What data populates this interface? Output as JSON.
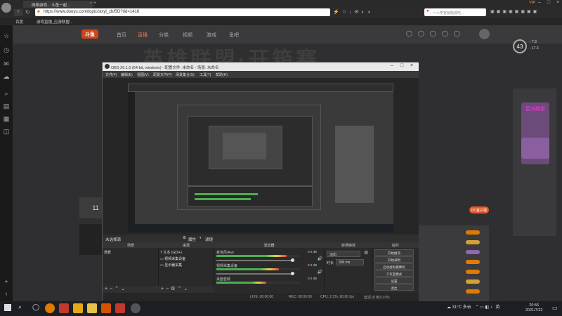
{
  "browser": {
    "tab_title": "网络游戏... 斗鱼一起...",
    "new_tab_icon": "plus-icon",
    "vip_label": "VIP",
    "url": "https://www.douyu.com/topic/stxyl_zb/BD?rid=1416",
    "search_placeholder": "一人吃官就能成吃...",
    "bookmarks": [
      "百度",
      "游戏直播_应游联盟..."
    ]
  },
  "site": {
    "logo_text": "斗鱼",
    "nav": [
      "首页",
      "直播",
      "分类",
      "视频",
      "游戏",
      "鱼吧"
    ],
    "banner_title": "英雄联盟·开箱赛",
    "level": "43",
    "speed_up": "7.3",
    "speed_down": "17.3",
    "promo_text": "星光殿堂",
    "date_day": "11",
    "pc_button": "PC客户端"
  },
  "obs": {
    "title": "OBS 26.1.0 (64-bit, windows) - 配置文件: 未命名 - 场景: 未命名",
    "menu": [
      "文件(F)",
      "编辑(E)",
      "视图(V)",
      "配置文件(P)",
      "场景集合(S)",
      "工具(T)",
      "帮助(H)"
    ],
    "scene_bar": {
      "current": "未选择源",
      "properties": "属性",
      "filters": "滤镜"
    },
    "docks": {
      "scenes": {
        "title": "场景",
        "items": [
          "场景"
        ]
      },
      "sources": {
        "title": "来源",
        "items": [
          "文本 (GDI+)",
          "视频采集设备",
          "显示器采集"
        ]
      },
      "mixer": {
        "title": "混音器",
        "channels": [
          {
            "name": "麦克风/Aux",
            "db": "0.0 dB",
            "level": 0.85
          },
          {
            "name": "视频采集设备",
            "db": "0.0 dB",
            "level": 0.75
          },
          {
            "name": "桌面音频",
            "db": "0.0 dB",
            "level": 0.6
          }
        ]
      },
      "transitions": {
        "title": "转场特效",
        "type": "淡出",
        "duration_label": "时长",
        "duration": "300 ms"
      },
      "controls": {
        "title": "控件",
        "buttons": [
          "开始推流",
          "开始录制",
          "启动虚拟摄像机",
          "工作室模式",
          "设置",
          "退出"
        ]
      }
    },
    "status": {
      "live": "LIVE: 00:00:00",
      "rec": "REC: 00:00:00",
      "cpu": "CPU: 2.1%, 60.00 fps",
      "dropped": "延迟 (0 帧) 0.0%"
    }
  },
  "taskbar": {
    "weather": "31°C 多云",
    "ime": "英",
    "time": "20:56",
    "date": "2021/7/22"
  }
}
